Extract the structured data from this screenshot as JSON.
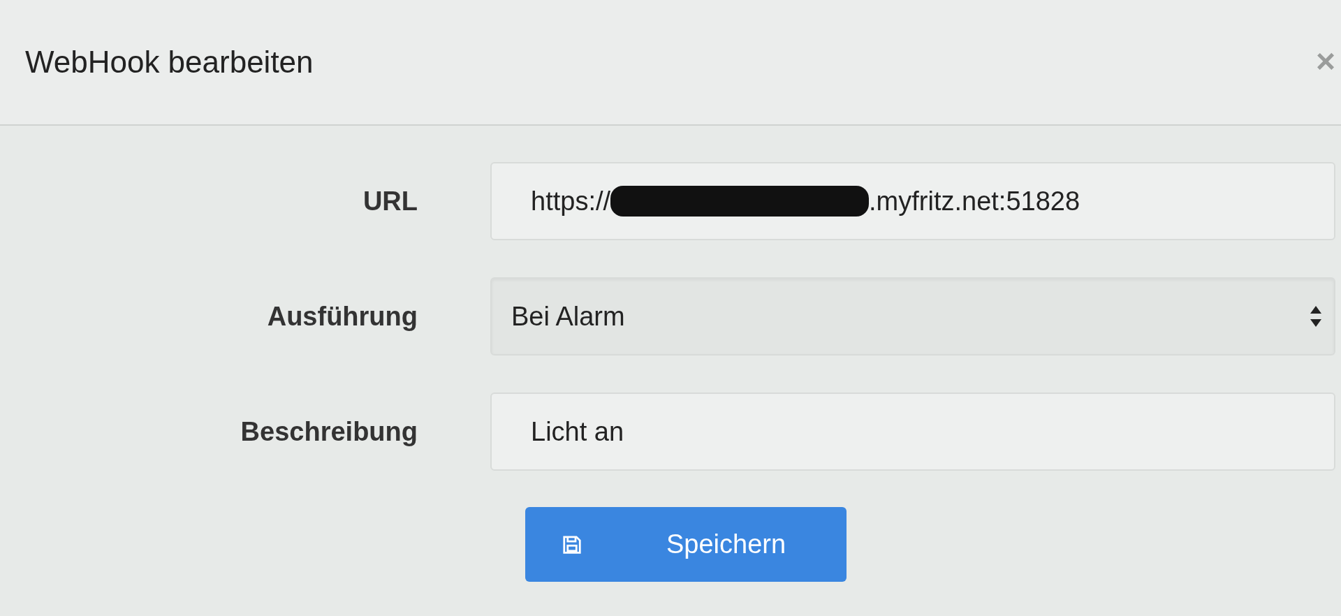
{
  "dialog": {
    "title": "WebHook bearbeiten",
    "close": "×"
  },
  "fields": [
    {
      "kind": "url",
      "label": "URL",
      "value_start": "https://",
      "redacted": true,
      "value_end": ".myfritz.net:51828"
    },
    {
      "kind": "select",
      "label": "Ausführung",
      "value": "Bei Alarm"
    },
    {
      "kind": "text",
      "label": "Beschreibung",
      "value": "Licht an"
    }
  ],
  "save_button": {
    "label": "Speichern"
  }
}
